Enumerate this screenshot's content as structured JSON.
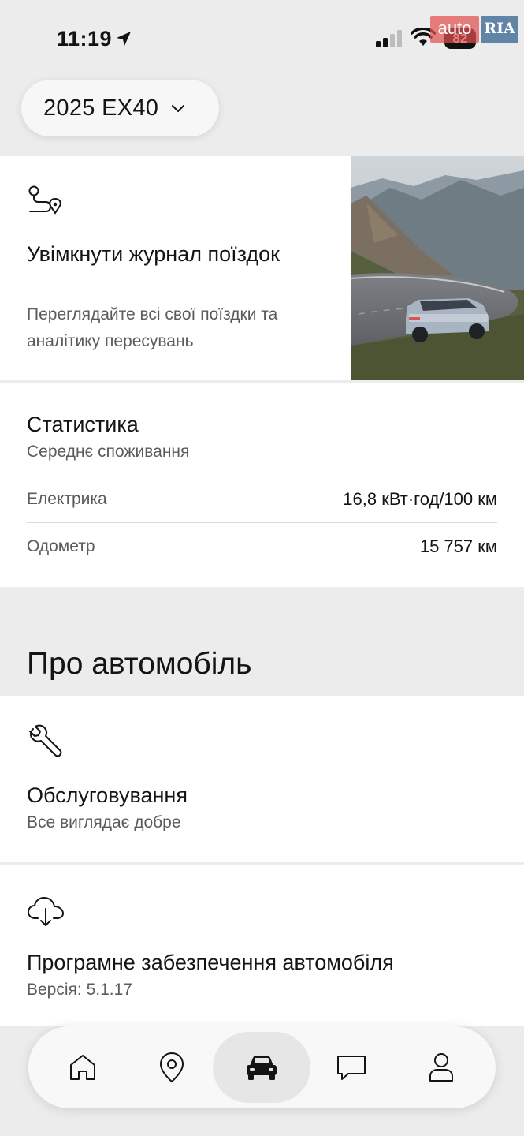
{
  "status_bar": {
    "time": "11:19",
    "battery": "82"
  },
  "watermark": {
    "part1": "auto",
    "part2": "RIA"
  },
  "header": {
    "model_label": "2025 EX40"
  },
  "trips_card": {
    "title": "Увімкнути журнал поїздок",
    "subtitle": "Переглядайте всі свої поїздки та аналітику пересувань",
    "icon": "route-icon",
    "image": "car-on-mountain-road-photo"
  },
  "stats": {
    "title": "Статистика",
    "subtitle": "Середнє споживання",
    "rows": [
      {
        "label": "Електрика",
        "value": "16,8 кВт·год/100 км"
      },
      {
        "label": "Одометр",
        "value": "15 757 км"
      }
    ]
  },
  "about": {
    "heading": "Про автомобіль",
    "items": [
      {
        "title": "Обслуговування",
        "subtitle": "Все виглядає добре",
        "icon": "wrench-icon"
      },
      {
        "title": "Програмне забезпечення автомобіля",
        "subtitle": "Версія: 5.1.17",
        "icon": "cloud-download-icon"
      }
    ]
  },
  "nav": {
    "items": [
      "home-icon",
      "map-pin-icon",
      "car-icon",
      "chat-icon",
      "profile-icon"
    ],
    "active": "car-icon"
  },
  "colors": {
    "background": "#ececec",
    "card": "#ffffff",
    "text": "#141414",
    "muted": "#5b5b5b",
    "active_nav": "#e6e6e6"
  }
}
